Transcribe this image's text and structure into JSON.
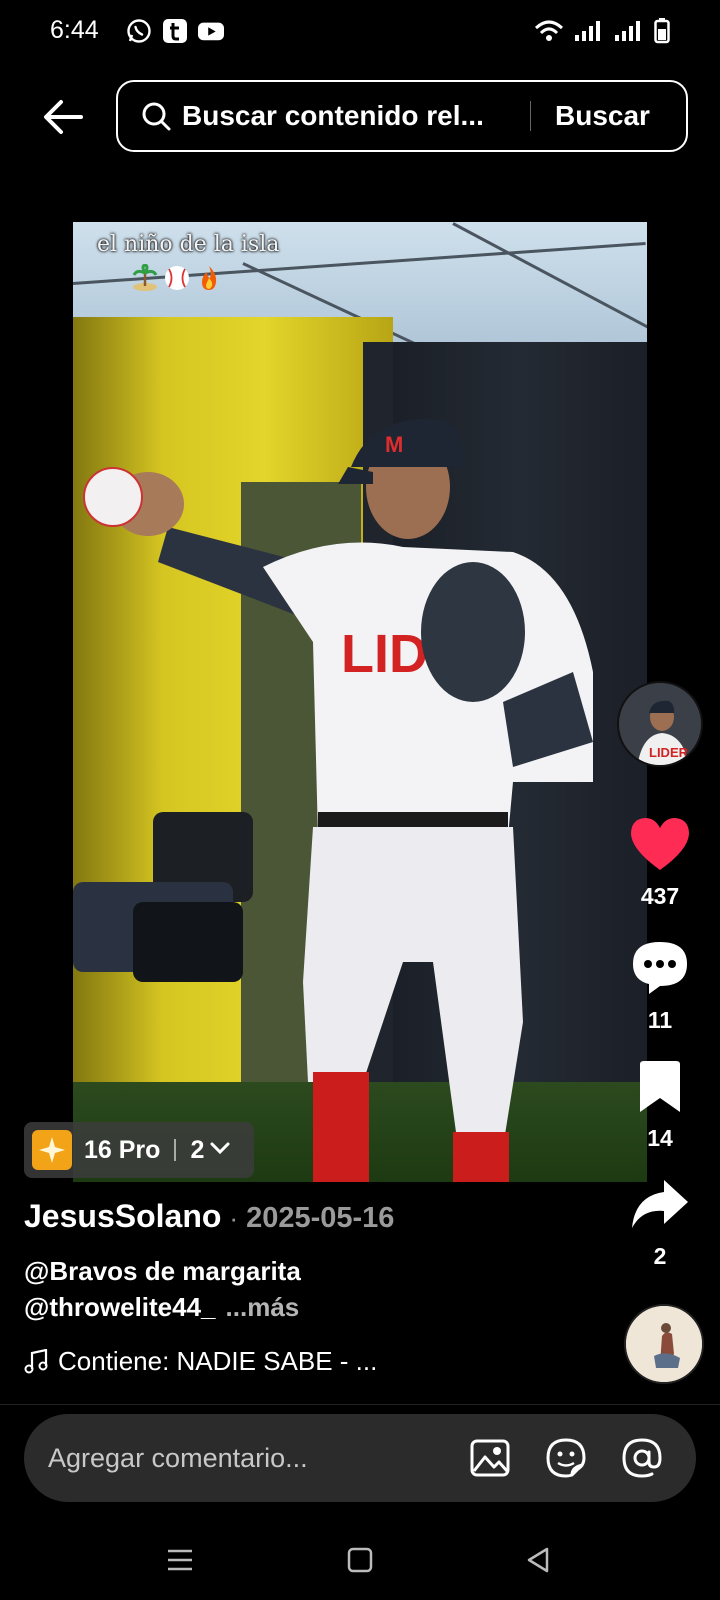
{
  "status_bar": {
    "time": "6:44",
    "apps": [
      "whatsapp-icon",
      "tumblr-icon",
      "youtube-icon"
    ],
    "indicators": [
      "wifi-icon",
      "signal-icon",
      "signal-icon",
      "battery-icon"
    ]
  },
  "header": {
    "search_placeholder": "Buscar contenido rel...",
    "search_button": "Buscar"
  },
  "video": {
    "caption_title": "el niño de la isla",
    "caption_emoji": "🏝️⚾🔥"
  },
  "badge": {
    "label": "16 Pro",
    "count": "2"
  },
  "rail": {
    "likes": "437",
    "comments": "11",
    "saves": "14",
    "shares": "2",
    "like_color": "#fe2c55"
  },
  "post": {
    "author": "JesusSolano",
    "separator": "·",
    "date": "2025-05-16",
    "mention1": "@Bravos de margarita",
    "mention2": "@throwelite44_",
    "more": "...más",
    "music": "Contiene: NADIE SABE - ..."
  },
  "comment_bar": {
    "placeholder": "Agregar comentario..."
  }
}
